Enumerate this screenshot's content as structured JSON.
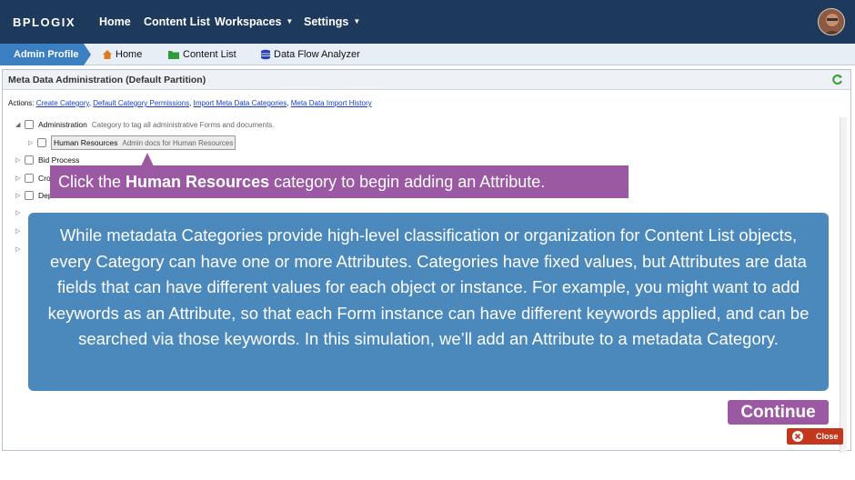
{
  "topbar": {
    "logo": "BPLOGIX",
    "nav": [
      "Home",
      "Content List",
      "Workspaces",
      "Settings"
    ]
  },
  "breadcrumbs": {
    "active": "Admin Profile",
    "items": [
      "Home",
      "Content List",
      "Data Flow Analyzer"
    ]
  },
  "panel": {
    "title": "Meta Data Administration (Default Partition)",
    "actions_label": "Actions:",
    "actions": [
      "Create Category",
      "Default Category Permissions",
      "Import Meta Data Categories",
      "Meta Data Import History"
    ]
  },
  "tree": {
    "administration": {
      "label": "Administration",
      "desc": "Category to tag all administrative Forms and documents."
    },
    "human_resources": {
      "label": "Human Resources",
      "desc": "Admin docs for Human Resources"
    },
    "bid_process": {
      "label": "Bid Process"
    },
    "cross": {
      "label": "Cros"
    },
    "dept": {
      "label": "Depa"
    }
  },
  "hint": {
    "prefix": "Click the ",
    "emphasis": "Human Resources",
    "suffix": " category to begin adding an Attribute."
  },
  "info_text": "While metadata Categories provide high-level classification or organization for Content List objects, every Category can have one or more Attributes. Categories have fixed values, but Attributes are data fields that can have different values for each object or instance. For example, you might want to add keywords as an Attribute, so that each Form instance can have different keywords applied, and can be searched via those keywords. In this simulation, we’ll add an Attribute to a metadata Category.",
  "buttons": {
    "continue": "Continue",
    "close": "Close"
  },
  "colors": {
    "nav_bg": "#1d3a5c",
    "callout_purple": "#9b59a3",
    "info_blue": "#4b88bc",
    "close_red": "#c4371d"
  }
}
